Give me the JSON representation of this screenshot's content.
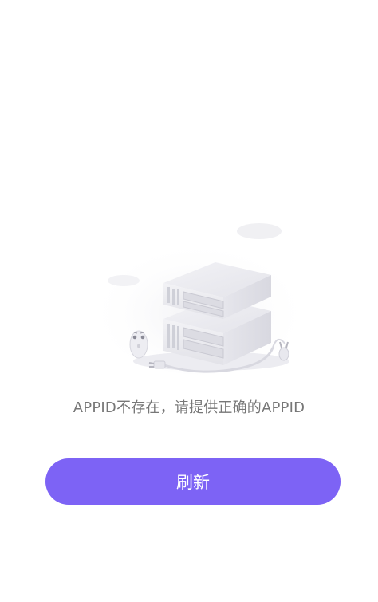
{
  "error_state": {
    "message": "APPID不存在，请提供正确的APPID",
    "illustration_icon": "server-disconnected-icon"
  },
  "actions": {
    "refresh_label": "刷新"
  },
  "colors": {
    "primary": "#7d63f5",
    "message_text": "#777777",
    "background": "#ffffff"
  }
}
